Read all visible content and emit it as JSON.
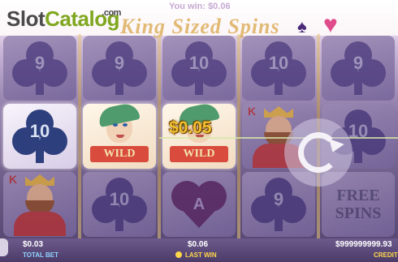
{
  "header": {
    "logo_slot": "Slot",
    "logo_catalog": "Catalog",
    "logo_com": ".com",
    "you_win": "You win: $0.06",
    "title": "King Sized Spins"
  },
  "reels": {
    "symbols": {
      "club_value": "10",
      "club_nine": "9",
      "wild_label": "WILD",
      "king_letter": "K",
      "heart_letter": "A",
      "free_spins_line1": "FREE",
      "free_spins_line2": "SPINS"
    },
    "line_win": "$0.05"
  },
  "bottom_bar": {
    "total_bet_value": "$0.03",
    "total_bet_label": "TOTAL BET",
    "last_win_value": "$0.06",
    "last_win_label": "LAST WIN",
    "credit_value": "$999999999.93",
    "credit_label": "CREDIT"
  },
  "colors": {
    "gold": "#f1c232",
    "win_label": "#ffd84a",
    "bet_label": "#8fd3ff"
  }
}
